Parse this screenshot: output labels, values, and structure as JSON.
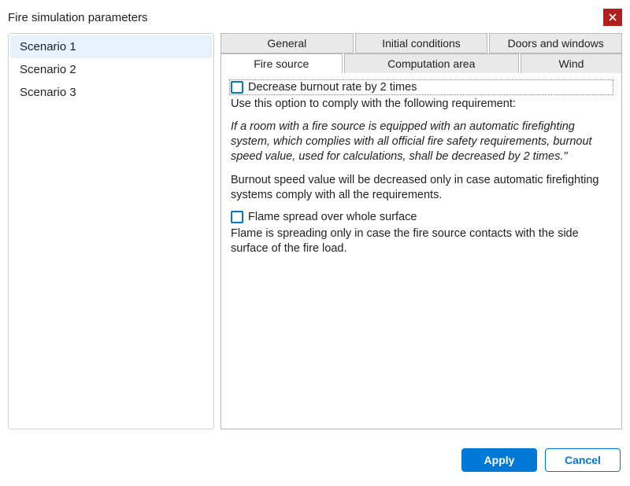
{
  "window": {
    "title": "Fire simulation parameters"
  },
  "sidebar": {
    "items": [
      {
        "label": "Scenario 1",
        "selected": true
      },
      {
        "label": "Scenario 2",
        "selected": false
      },
      {
        "label": "Scenario 3",
        "selected": false
      }
    ]
  },
  "tabs": {
    "row1": [
      {
        "label": "General"
      },
      {
        "label": "Initial conditions"
      },
      {
        "label": "Doors and windows"
      }
    ],
    "row2": [
      {
        "label": "Fire source",
        "active": true
      },
      {
        "label": "Computation area"
      },
      {
        "label": "Wind"
      }
    ]
  },
  "fire_source": {
    "decrease_checkbox_label": "Decrease burnout rate by 2 times",
    "decrease_intro": "Use this option to comply with the following requirement:",
    "decrease_quote": "If a room with a fire source is equipped with an automatic firefighting system, which complies with all official fire safety requirements, burnout speed value, used for calculations, shall be decreased by 2 times.\"",
    "decrease_note": "Burnout speed value will be decreased only in case automatic firefighting systems comply with all the requirements.",
    "flame_checkbox_label": "Flame spread over whole surface",
    "flame_note": "Flame is spreading only in case the fire source contacts with the side surface of the fire load."
  },
  "footer": {
    "apply": "Apply",
    "cancel": "Cancel"
  }
}
